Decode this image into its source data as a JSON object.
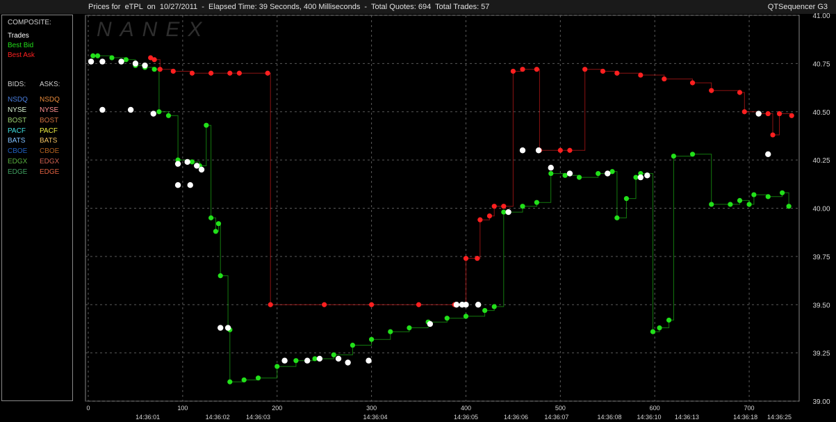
{
  "header": {
    "title": "Prices for  eTPL  on  10/27/2011  -  Elapsed Time: 39 Seconds, 400 Milliseconds  -  Total Quotes: 694  Total Trades: 57",
    "app": "QTSequencer G3",
    "watermark": "NANEX"
  },
  "legend": {
    "composite_heading": "COMPOSITE:",
    "composite": [
      {
        "label": "Trades",
        "color": "#ffffff"
      },
      {
        "label": "Best Bid",
        "color": "#22e01a"
      },
      {
        "label": "Best Ask",
        "color": "#ff2020"
      }
    ],
    "bids_heading": "BIDS:",
    "asks_heading": "ASKS:",
    "exchanges": [
      {
        "bid": "NSDQ",
        "ask": "NSDQ",
        "bid_color": "#4a7fe0",
        "ask_color": "#e88a3a"
      },
      {
        "bid": "NYSE",
        "ask": "NYSE",
        "bid_color": "#d8f0d0",
        "ask_color": "#ff9090"
      },
      {
        "bid": "BOST",
        "ask": "BOST",
        "bid_color": "#9ad070",
        "ask_color": "#d07040"
      },
      {
        "bid": "PACF",
        "ask": "PACF",
        "bid_color": "#40e0e0",
        "ask_color": "#f0f040"
      },
      {
        "bid": "BATS",
        "ask": "BATS",
        "bid_color": "#80c0ff",
        "ask_color": "#f0c060"
      },
      {
        "bid": "CBOE",
        "ask": "CBOE",
        "bid_color": "#2060c0",
        "ask_color": "#b06020"
      },
      {
        "bid": "EDGX",
        "ask": "EDGX",
        "bid_color": "#58b040",
        "ask_color": "#d06050"
      },
      {
        "bid": "EDGE",
        "ask": "EDGE",
        "bid_color": "#40a060",
        "ask_color": "#e06040"
      }
    ]
  },
  "chart_data": {
    "type": "line",
    "xlim": [
      0,
      750
    ],
    "ylim": [
      39.0,
      41.0
    ],
    "y_ticks": [
      "39.00",
      "39.25",
      "39.50",
      "39.75",
      "40.00",
      "40.25",
      "40.50",
      "40.75",
      "41.00"
    ],
    "x_ticks": [
      0,
      100,
      200,
      300,
      400,
      500,
      600,
      700
    ],
    "time_labels": [
      {
        "x": 63,
        "label": "14:36:01"
      },
      {
        "x": 137,
        "label": "14:36:02"
      },
      {
        "x": 180,
        "label": "14:36:03"
      },
      {
        "x": 304,
        "label": "14:36:04"
      },
      {
        "x": 400,
        "label": "14:36:05"
      },
      {
        "x": 453,
        "label": "14:36:06"
      },
      {
        "x": 496,
        "label": "14:36:07"
      },
      {
        "x": 552,
        "label": "14:36:08"
      },
      {
        "x": 594,
        "label": "14:36:10"
      },
      {
        "x": 634,
        "label": "14:36:13"
      },
      {
        "x": 696,
        "label": "14:36:18"
      },
      {
        "x": 732,
        "label": "14:36:25"
      }
    ],
    "grid": true,
    "legend_position": "left panel",
    "series": [
      {
        "name": "Best Bid",
        "color": "#22e01a",
        "points": [
          [
            5,
            40.79
          ],
          [
            10,
            40.79
          ],
          [
            25,
            40.78
          ],
          [
            40,
            40.77
          ],
          [
            50,
            40.74
          ],
          [
            60,
            40.73
          ],
          [
            70,
            40.72
          ],
          [
            75,
            40.5
          ],
          [
            85,
            40.48
          ],
          [
            95,
            40.25
          ],
          [
            110,
            40.24
          ],
          [
            118,
            40.22
          ],
          [
            125,
            40.43
          ],
          [
            130,
            39.95
          ],
          [
            135,
            39.88
          ],
          [
            138,
            39.92
          ],
          [
            140,
            39.65
          ],
          [
            148,
            39.38
          ],
          [
            150,
            39.37
          ],
          [
            150,
            39.1
          ],
          [
            165,
            39.11
          ],
          [
            180,
            39.12
          ],
          [
            200,
            39.18
          ],
          [
            220,
            39.21
          ],
          [
            240,
            39.22
          ],
          [
            260,
            39.24
          ],
          [
            280,
            39.29
          ],
          [
            300,
            39.32
          ],
          [
            320,
            39.36
          ],
          [
            340,
            39.38
          ],
          [
            360,
            39.41
          ],
          [
            380,
            39.43
          ],
          [
            400,
            39.44
          ],
          [
            420,
            39.47
          ],
          [
            430,
            39.49
          ],
          [
            440,
            39.98
          ],
          [
            460,
            40.01
          ],
          [
            475,
            40.03
          ],
          [
            490,
            40.18
          ],
          [
            505,
            40.17
          ],
          [
            520,
            40.16
          ],
          [
            540,
            40.18
          ],
          [
            555,
            40.19
          ],
          [
            560,
            39.95
          ],
          [
            570,
            40.05
          ],
          [
            580,
            40.16
          ],
          [
            585,
            40.18
          ],
          [
            598,
            39.36
          ],
          [
            605,
            39.38
          ],
          [
            615,
            39.42
          ],
          [
            620,
            40.27
          ],
          [
            640,
            40.28
          ],
          [
            660,
            40.02
          ],
          [
            680,
            40.02
          ],
          [
            690,
            40.04
          ],
          [
            700,
            40.02
          ],
          [
            705,
            40.07
          ],
          [
            720,
            40.06
          ],
          [
            735,
            40.08
          ],
          [
            742,
            40.01
          ]
        ]
      },
      {
        "name": "Best Ask",
        "color": "#ff2020",
        "points": [
          [
            66,
            40.78
          ],
          [
            70,
            40.77
          ],
          [
            76,
            40.72
          ],
          [
            90,
            40.71
          ],
          [
            110,
            40.7
          ],
          [
            130,
            40.7
          ],
          [
            150,
            40.7
          ],
          [
            160,
            40.7
          ],
          [
            190,
            40.7
          ],
          [
            193,
            39.5
          ],
          [
            250,
            39.5
          ],
          [
            300,
            39.5
          ],
          [
            350,
            39.5
          ],
          [
            388,
            39.5
          ],
          [
            400,
            39.74
          ],
          [
            412,
            39.74
          ],
          [
            415,
            39.94
          ],
          [
            425,
            39.96
          ],
          [
            430,
            40.01
          ],
          [
            440,
            40.01
          ],
          [
            450,
            40.71
          ],
          [
            460,
            40.72
          ],
          [
            475,
            40.72
          ],
          [
            478,
            40.3
          ],
          [
            500,
            40.3
          ],
          [
            510,
            40.3
          ],
          [
            526,
            40.72
          ],
          [
            545,
            40.71
          ],
          [
            560,
            40.7
          ],
          [
            585,
            40.69
          ],
          [
            610,
            40.67
          ],
          [
            640,
            40.65
          ],
          [
            660,
            40.61
          ],
          [
            690,
            40.6
          ],
          [
            695,
            40.5
          ],
          [
            710,
            40.49
          ],
          [
            720,
            40.49
          ],
          [
            725,
            40.38
          ],
          [
            732,
            40.49
          ],
          [
            745,
            40.48
          ]
        ]
      },
      {
        "name": "Trades",
        "color": "#ffffff",
        "points": [
          [
            3,
            40.76
          ],
          [
            15,
            40.76
          ],
          [
            35,
            40.76
          ],
          [
            50,
            40.75
          ],
          [
            60,
            40.74
          ],
          [
            15,
            40.51
          ],
          [
            45,
            40.51
          ],
          [
            69,
            40.49
          ],
          [
            95,
            40.23
          ],
          [
            105,
            40.24
          ],
          [
            115,
            40.22
          ],
          [
            120,
            40.2
          ],
          [
            108,
            40.12
          ],
          [
            95,
            40.12
          ],
          [
            140,
            39.38
          ],
          [
            148,
            39.38
          ],
          [
            208,
            39.21
          ],
          [
            232,
            39.21
          ],
          [
            245,
            39.22
          ],
          [
            265,
            39.22
          ],
          [
            275,
            39.2
          ],
          [
            297,
            39.21
          ],
          [
            362,
            39.4
          ],
          [
            390,
            39.5
          ],
          [
            396,
            39.5
          ],
          [
            400,
            39.5
          ],
          [
            413,
            39.5
          ],
          [
            445,
            39.98
          ],
          [
            460,
            40.3
          ],
          [
            477,
            40.3
          ],
          [
            490,
            40.21
          ],
          [
            510,
            40.18
          ],
          [
            550,
            40.18
          ],
          [
            585,
            40.16
          ],
          [
            592,
            40.17
          ],
          [
            720,
            40.28
          ],
          [
            710,
            40.49
          ]
        ]
      }
    ]
  }
}
